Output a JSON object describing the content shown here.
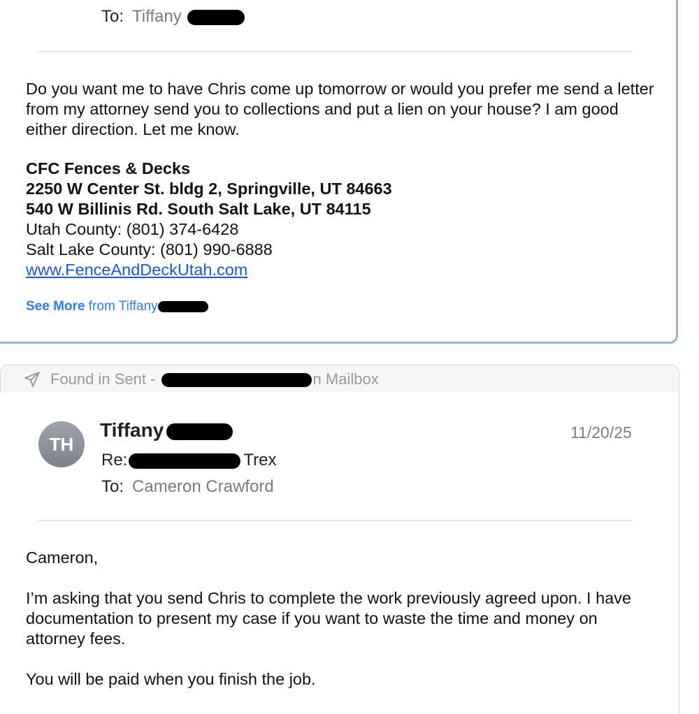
{
  "first_message": {
    "to_label": "To:",
    "to_value": "Tiffany",
    "body_text": "Do you want me to have Chris come up tomorrow or would you prefer me send a letter from my attorney send you to collections and put a lien on your house? I am good either direction. Let me know.",
    "signature": {
      "company": "CFC Fences & Decks",
      "address1": "2250 W Center St. bldg 2, Springville, UT 84663",
      "address2": "540 W Billinis Rd. South Salt Lake, UT 84115",
      "phone_utah": "Utah County: (801) 374-6428",
      "phone_salt_lake": "Salt Lake County: (801) 990-6888",
      "website": "www.FenceAndDeckUtah.com"
    },
    "see_more_bold": "See More",
    "see_more_rest": "from Tiffany"
  },
  "found_in": {
    "prefix": "Found in Sent - ",
    "suffix": "n Mailbox",
    "icon": "paper-plane-icon"
  },
  "second_message": {
    "avatar_initials": "TH",
    "sender": "Tiffany",
    "date": "11/20/25",
    "subject_label": "Re:",
    "subject_suffix": "Trex",
    "to_label": "To:",
    "to_value": "Cameron Crawford",
    "greeting": "Cameron,",
    "paragraph1": "I’m asking that you send Chris to complete the work previously agreed upon. I have documentation to present my case if you want to waste the time and money on attorney fees.",
    "paragraph2": "You will be paid when you finish the job."
  },
  "colors": {
    "accent_border": "#8fb3ee",
    "link": "#1a57d6",
    "see_more": "#2f7be8"
  }
}
